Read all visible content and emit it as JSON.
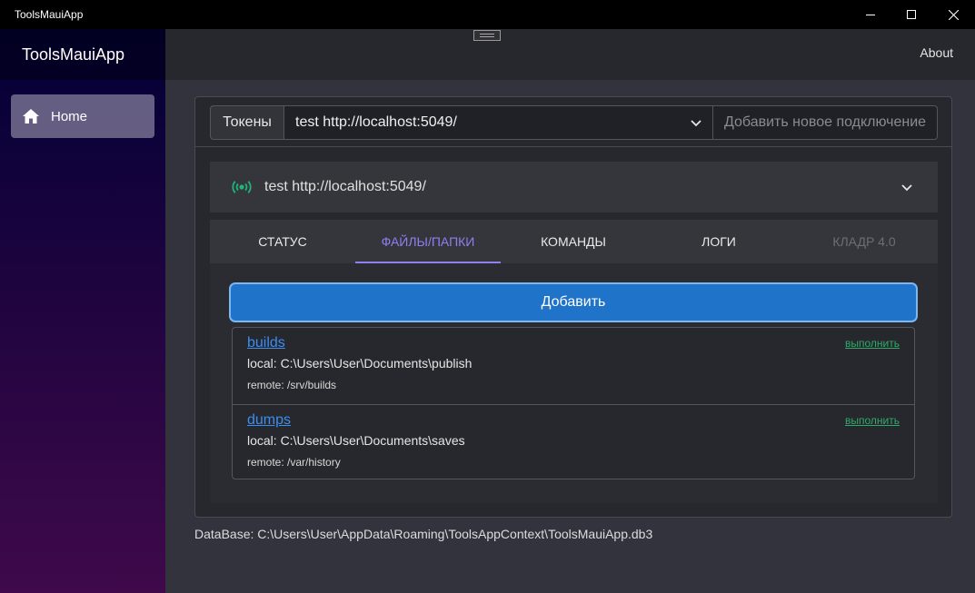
{
  "window": {
    "title": "ToolsMauiApp"
  },
  "sidebar": {
    "app_name": "ToolsMauiApp",
    "items": [
      {
        "label": "Home",
        "icon": "home-icon"
      }
    ]
  },
  "topbar": {
    "about_label": "About"
  },
  "connection": {
    "tokens_label": "Токены",
    "selected": "test http://localhost:5049/",
    "new_placeholder": "Добавить новое подключение"
  },
  "accordion": {
    "title": "test http://localhost:5049/",
    "icon": "broadcast-icon",
    "icon_color": "#1fb57a"
  },
  "tabs": [
    {
      "label": "СТАТУС",
      "state": "normal"
    },
    {
      "label": "ФАЙЛЫ/ПАПКИ",
      "state": "active"
    },
    {
      "label": "КОМАНДЫ",
      "state": "normal"
    },
    {
      "label": "ЛОГИ",
      "state": "normal"
    },
    {
      "label": "КЛАДР 4.0",
      "state": "disabled"
    }
  ],
  "files": {
    "add_label": "Добавить",
    "items": [
      {
        "name": "builds",
        "local": "local: C:\\Users\\User\\Documents\\publish",
        "remote": "remote: /srv/builds",
        "action": "выполнить"
      },
      {
        "name": "dumps",
        "local": "local: C:\\Users\\User\\Documents\\saves",
        "remote": "remote: /var/history",
        "action": "выполнить"
      }
    ]
  },
  "footer": {
    "db_path": "DataBase: C:\\Users\\User\\AppData\\Roaming\\ToolsAppContext\\ToolsMauiApp.db3"
  },
  "colors": {
    "accent": "#8f7ff0",
    "primary_button": "#1f73c9",
    "link": "#3b8ef0",
    "action_link": "#2eaa68"
  }
}
